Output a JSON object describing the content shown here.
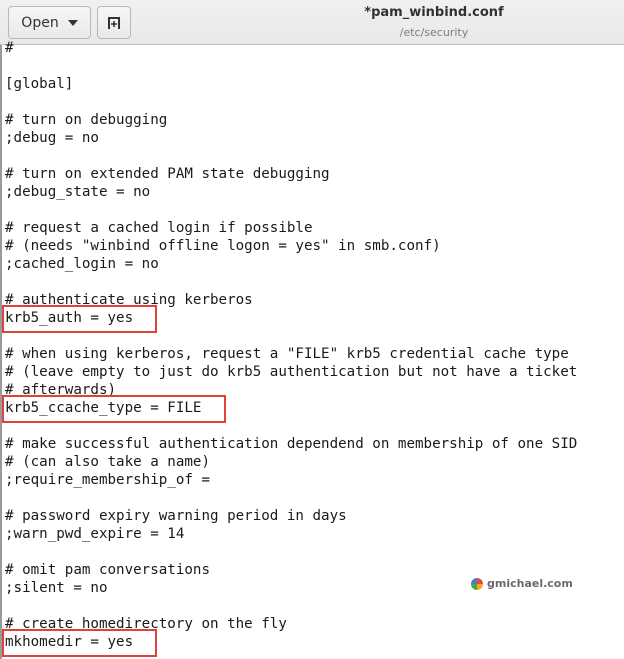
{
  "header": {
    "open_label": "Open",
    "new_tab_icon": "new-document-icon",
    "title": "*pam_winbind.conf",
    "subtitle": "/etc/security"
  },
  "editor": {
    "lines": [
      "#",
      "",
      "[global]",
      "",
      "# turn on debugging",
      ";debug = no",
      "",
      "# turn on extended PAM state debugging",
      ";debug_state = no",
      "",
      "# request a cached login if possible",
      "# (needs \"winbind offline logon = yes\" in smb.conf)",
      ";cached_login = no",
      "",
      "# authenticate using kerberos",
      "krb5_auth = yes",
      "",
      "# when using kerberos, request a \"FILE\" krb5 credential cache type",
      "# (leave empty to just do krb5 authentication but not have a ticket",
      "# afterwards)",
      "krb5_ccache_type = FILE",
      "",
      "# make successful authentication dependend on membership of one SID",
      "# (can also take a name)",
      ";require_membership_of =",
      "",
      "# password expiry warning period in days",
      ";warn_pwd_expire = 14",
      "",
      "# omit pam conversations",
      ";silent = no",
      "",
      "# create homedirectory on the fly",
      "mkhomedir = yes"
    ],
    "highlighted": [
      "krb5_auth = yes",
      "krb5_ccache_type = FILE",
      "mkhomedir = yes"
    ],
    "highlight_color": "#e0413b"
  },
  "watermark": {
    "text": "gmichael.com"
  }
}
